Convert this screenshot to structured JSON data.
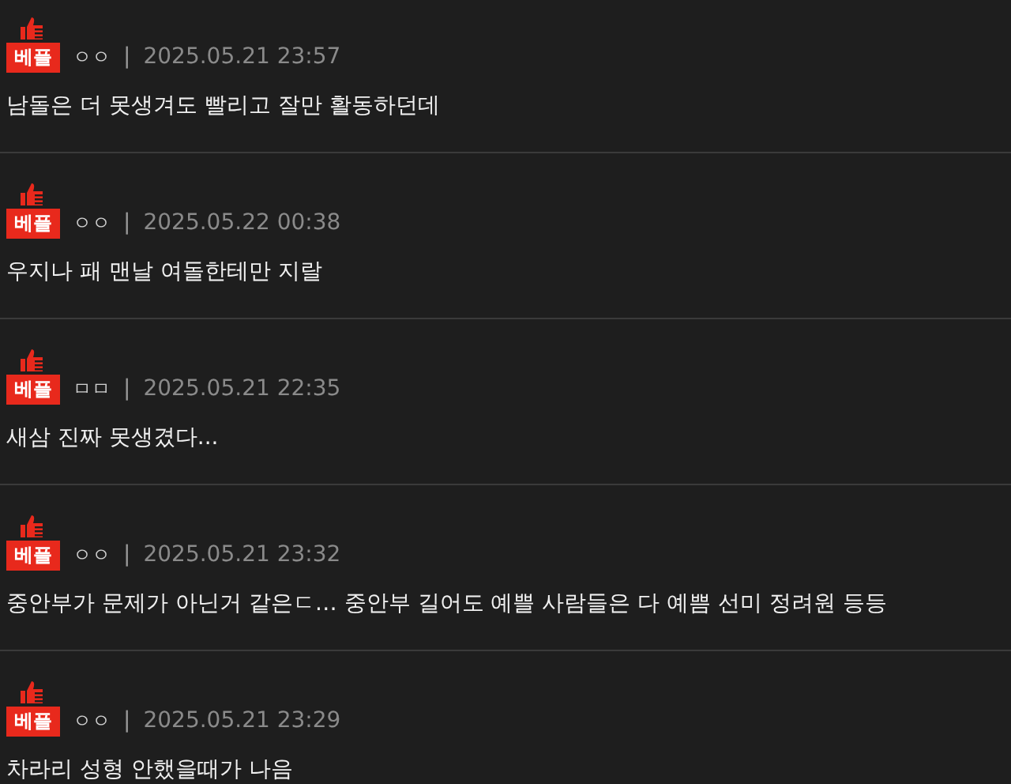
{
  "comments": [
    {
      "badge": "베플",
      "author": "ㅇㅇ",
      "separator": "|",
      "date": "2025.05.21 23:57",
      "text": "남돌은 더 못생겨도 빨리고 잘만 활동하던데"
    },
    {
      "badge": "베플",
      "author": "ㅇㅇ",
      "separator": "|",
      "date": "2025.05.22 00:38",
      "text": "우지나 패 맨날 여돌한테만 지랄"
    },
    {
      "badge": "베플",
      "author": "ㅁㅁ",
      "separator": "|",
      "date": "2025.05.21 22:35",
      "text": "새삼 진짜 못생겼다..."
    },
    {
      "badge": "베플",
      "author": "ㅇㅇ",
      "separator": "|",
      "date": "2025.05.21 23:32",
      "text": "중안부가 문제가 아닌거 같은ㄷ… 중안부 길어도 예쁠 사람들은 다 예쁨 선미 정려원 등등"
    },
    {
      "badge": "베플",
      "author": "ㅇㅇ",
      "separator": "|",
      "date": "2025.05.21 23:29",
      "text": "차라리 성형 안했을때가 나음"
    }
  ]
}
